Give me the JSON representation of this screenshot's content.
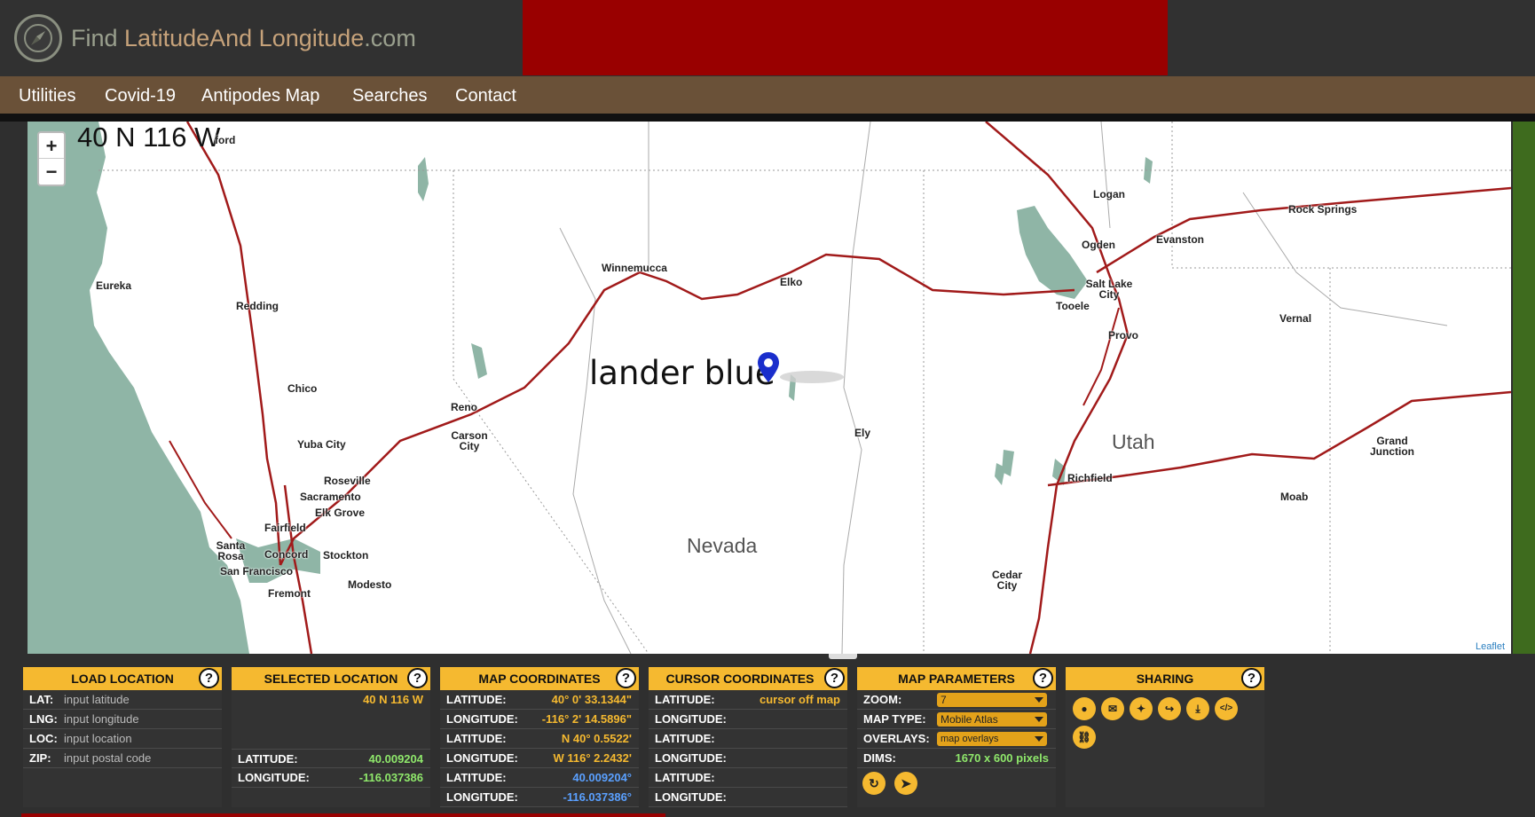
{
  "site": {
    "logo_part1": "Find ",
    "logo_part2": "LatitudeAnd",
    "logo_part3": "Longitude",
    "logo_part4": ".com"
  },
  "nav": [
    "Utilities",
    "Covid-19",
    "Antipodes Map",
    "Searches",
    "Contact"
  ],
  "map": {
    "title": "40 N 116 W",
    "zoom_in": "+",
    "zoom_out": "−",
    "marker_label": "lander blue",
    "attribution": "Leaflet",
    "cities": [
      "ford",
      "Logan",
      "Rock Springs",
      "Evanston",
      "Ogden",
      "Winnemucca",
      "Elko",
      "Salt Lake City",
      "Tooele",
      "Eureka",
      "Redding",
      "Vernal",
      "Provo",
      "Chico",
      "Reno",
      "Carson City",
      "Yuba City",
      "Ely",
      "Roseville",
      "Sacramento",
      "Richfield",
      "Grand Junction",
      "Elk Grove",
      "Santa Rosa",
      "Fairfield",
      "Moab",
      "Concord",
      "Stockton",
      "San Francisco",
      "Modesto",
      "Fremont",
      "Cedar City"
    ],
    "states": [
      "Nevada",
      "Utah"
    ]
  },
  "load_location": {
    "title": "LOAD LOCATION",
    "help": "?",
    "lat_label": "LAT:",
    "lat_placeholder": "input latitude",
    "lng_label": "LNG:",
    "lng_placeholder": "input longitude",
    "loc_label": "LOC:",
    "loc_placeholder": "input location",
    "zip_label": "ZIP:",
    "zip_placeholder": "input postal code"
  },
  "selected_location": {
    "title": "SELECTED LOCATION",
    "help": "?",
    "name": "40 N 116 W",
    "lat_label": "LATITUDE:",
    "lat_value": "40.009204",
    "lng_label": "LONGITUDE:",
    "lng_value": "-116.037386"
  },
  "map_coordinates": {
    "title": "MAP COORDINATES",
    "help": "?",
    "rows": [
      {
        "label": "LATITUDE:",
        "value": "40° 0' 33.1344\""
      },
      {
        "label": "LONGITUDE:",
        "value": "-116° 2' 14.5896\""
      },
      {
        "label": "LATITUDE:",
        "value": "N 40° 0.5522'"
      },
      {
        "label": "LONGITUDE:",
        "value": "W 116° 2.2432'"
      },
      {
        "label": "LATITUDE:",
        "value": "40.009204°"
      },
      {
        "label": "LONGITUDE:",
        "value": "-116.037386°"
      }
    ]
  },
  "cursor_coordinates": {
    "title": "CURSOR COORDINATES",
    "help": "?",
    "status": "cursor off map",
    "rows": [
      "LATITUDE:",
      "LONGITUDE:",
      "LATITUDE:",
      "LONGITUDE:",
      "LATITUDE:",
      "LONGITUDE:"
    ]
  },
  "map_parameters": {
    "title": "MAP PARAMETERS",
    "help": "?",
    "zoom_label": "ZOOM:",
    "zoom_value": "7",
    "type_label": "MAP TYPE:",
    "type_value": "Mobile Atlas",
    "overlays_label": "OVERLAYS:",
    "overlays_value": "map overlays",
    "dims_label": "DIMS:",
    "dims_value": "1670 x 600 pixels"
  },
  "sharing": {
    "title": "SHARING",
    "help": "?"
  },
  "colors": {
    "accent": "#f5b930",
    "nav_bg": "#6a5138",
    "banner": "#990000",
    "road": "#a11a1a",
    "water": "#8fb5a6"
  }
}
